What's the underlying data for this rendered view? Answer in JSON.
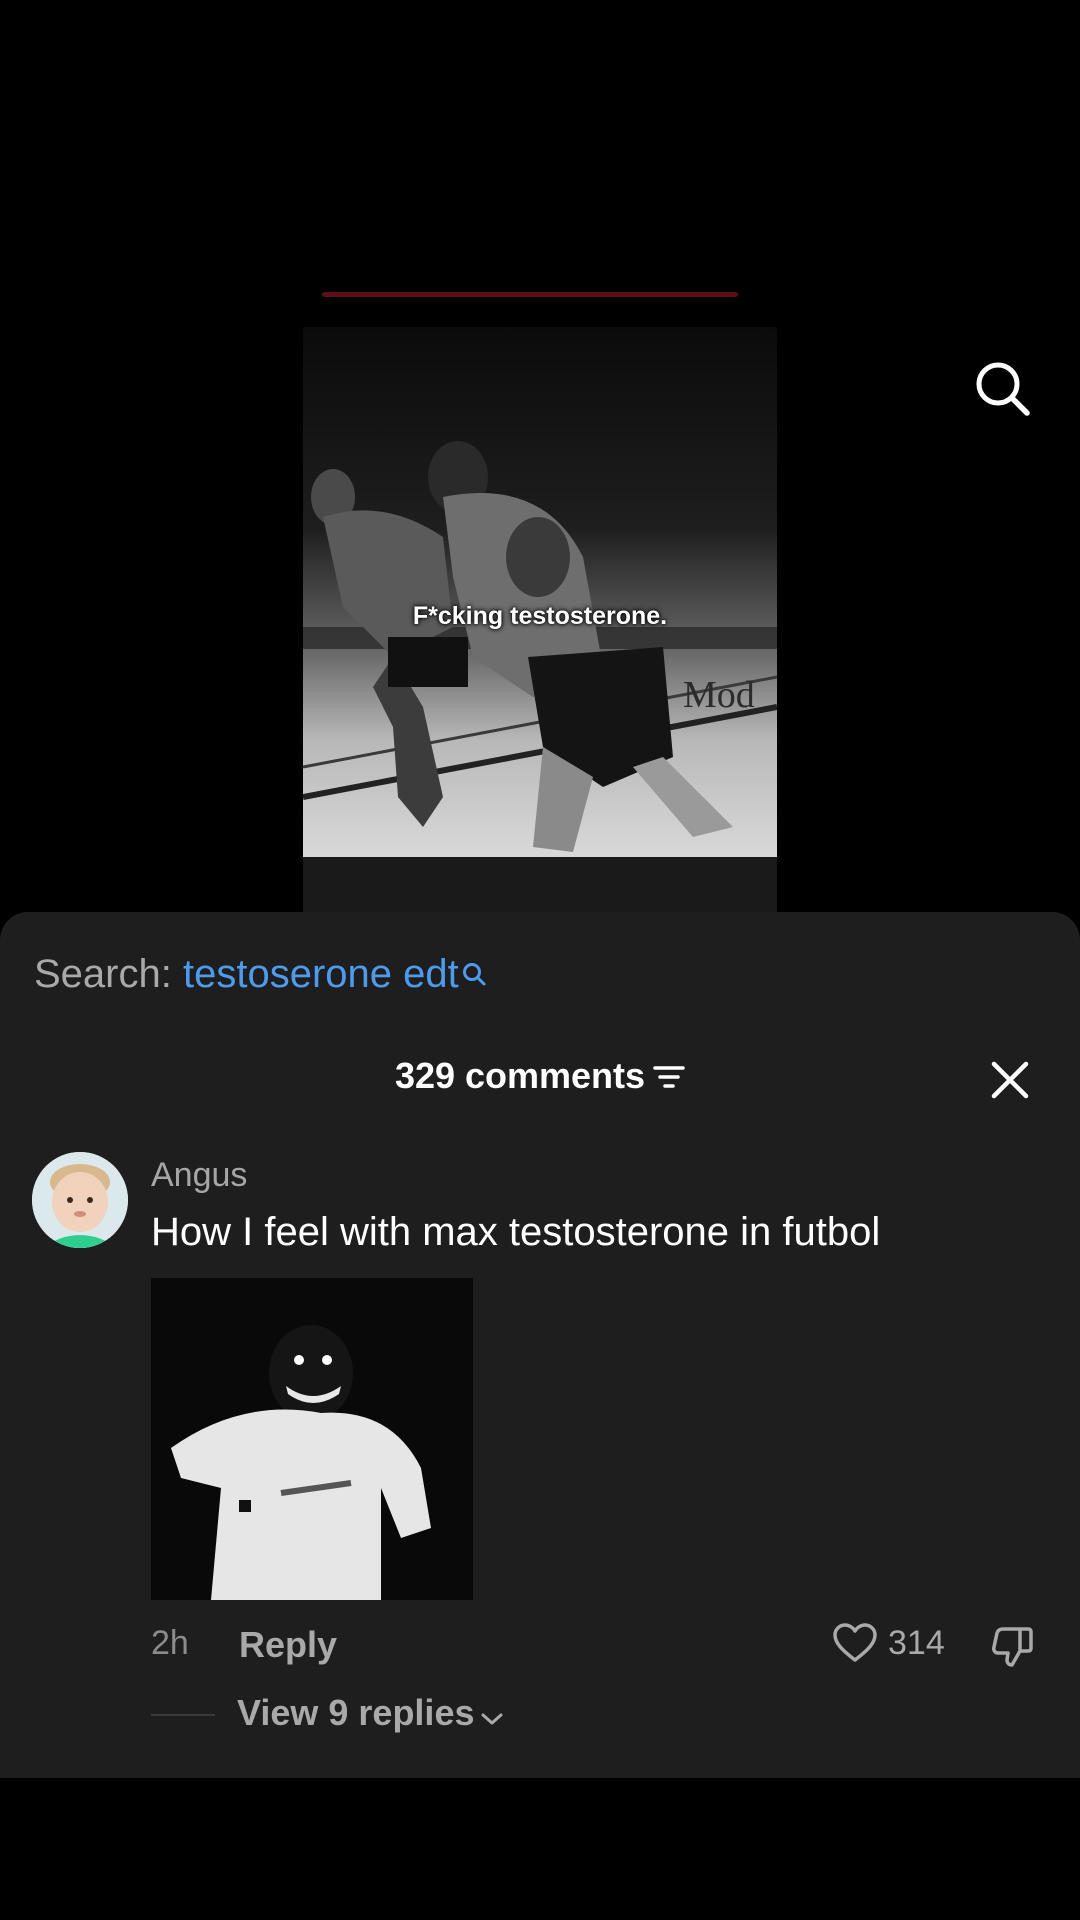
{
  "video": {
    "caption": "F*cking testosterone."
  },
  "search": {
    "prefix": "Search:",
    "term": "testoserone edt"
  },
  "comments": {
    "count_label": "329 comments"
  },
  "comment": {
    "username": "Angus",
    "text": "How I feel with max testosterone in futbol",
    "time": "2h",
    "reply_label": "Reply",
    "likes": "314",
    "view_replies": "View 9 replies"
  },
  "icons": {
    "search": "search-icon",
    "filter": "filter-icon",
    "close": "close-icon",
    "heart": "heart-icon",
    "dislike": "thumbs-down-icon",
    "chevron": "chevron-down-icon"
  },
  "colors": {
    "sheet_bg": "#1e1e1f",
    "link_blue": "#4e9bec",
    "muted_text": "#a9a9aa"
  }
}
